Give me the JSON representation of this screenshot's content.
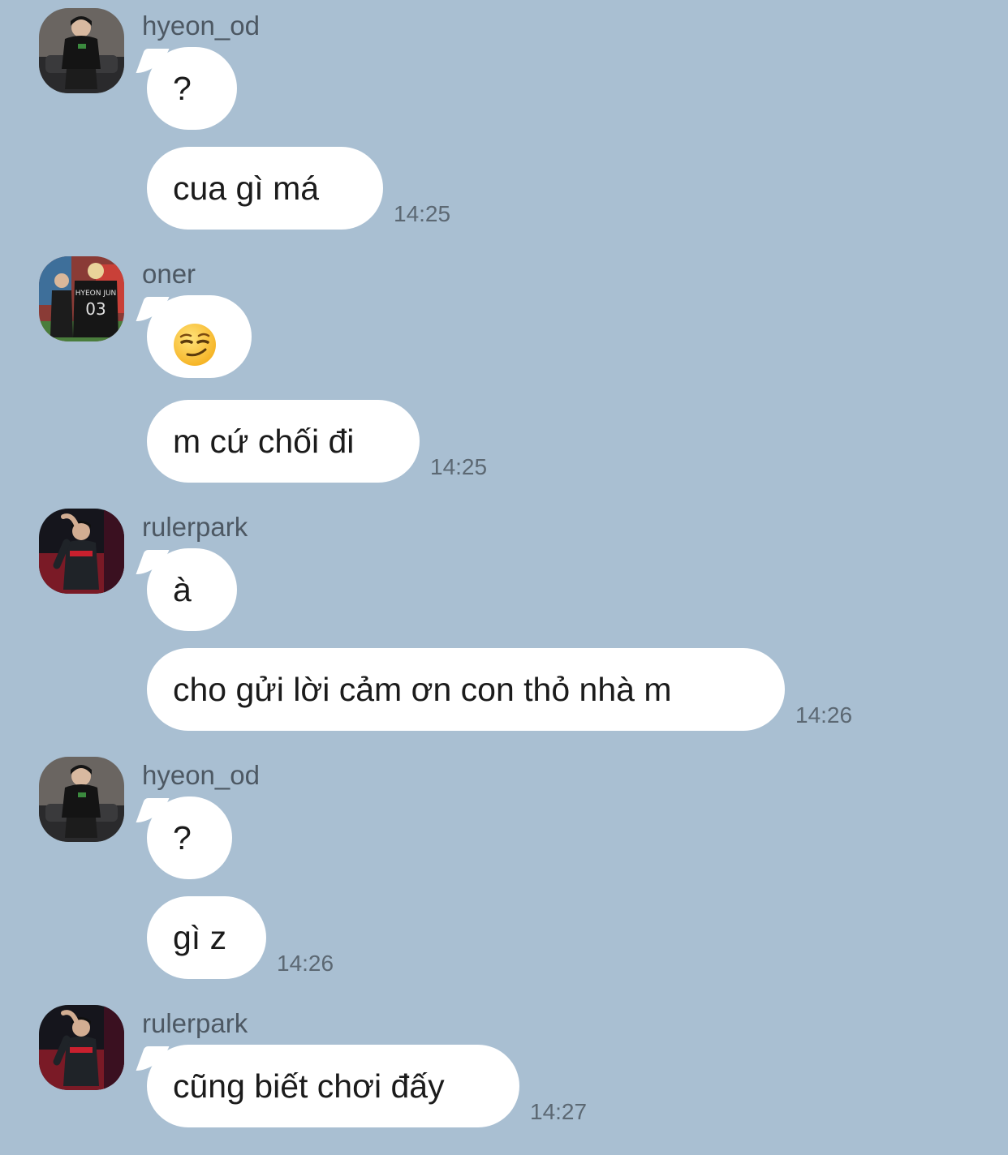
{
  "colors": {
    "background": "#a9bfd2",
    "bubble": "#ffffff",
    "sender_text": "#4d5863",
    "time_text": "#5c6873"
  },
  "messages": [
    {
      "sender": "hyeon_od",
      "avatar": "avatar-hyeon-od",
      "bubbles": [
        "?",
        "cua gì má"
      ],
      "time": "14:25"
    },
    {
      "sender": "oner",
      "avatar": "avatar-oner",
      "bubbles": [
        "smirking-face-emoji",
        "m cứ chối đi"
      ],
      "time": "14:25"
    },
    {
      "sender": "rulerpark",
      "avatar": "avatar-rulerpark",
      "bubbles": [
        "à",
        "cho gửi lời cảm ơn con thỏ nhà m"
      ],
      "time": "14:26"
    },
    {
      "sender": "hyeon_od",
      "avatar": "avatar-hyeon-od",
      "bubbles": [
        "?",
        "gì z"
      ],
      "time": "14:26"
    },
    {
      "sender": "rulerpark",
      "avatar": "avatar-rulerpark",
      "bubbles": [
        "cũng biết chơi đấy"
      ],
      "time": "14:27"
    }
  ]
}
